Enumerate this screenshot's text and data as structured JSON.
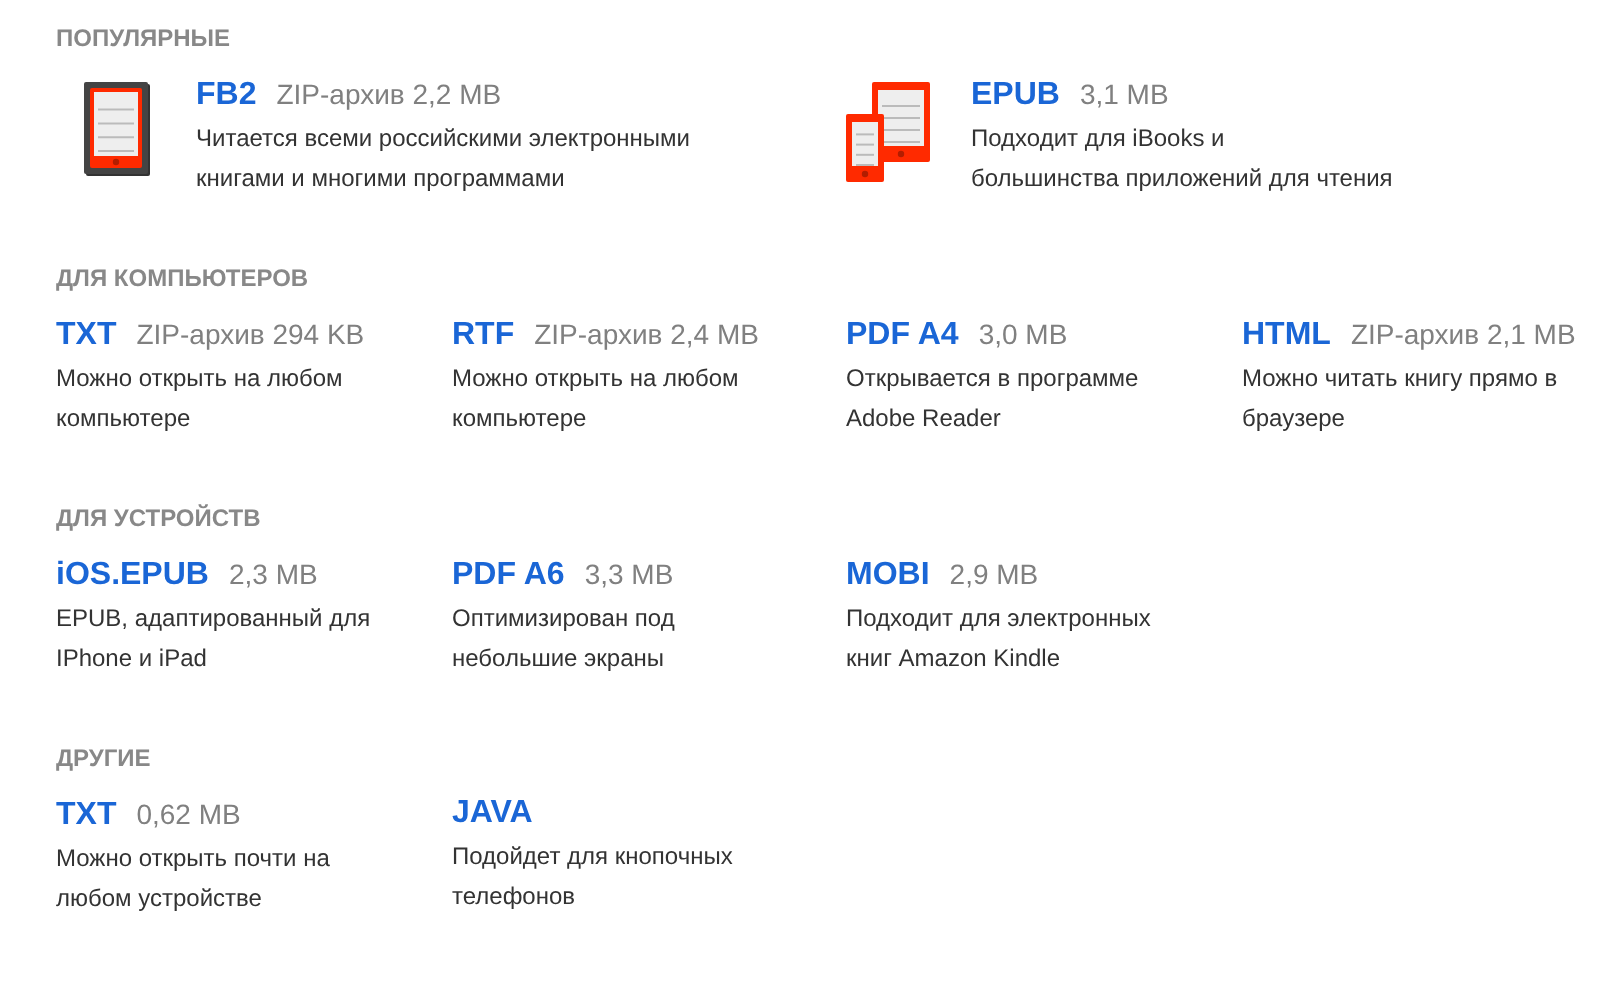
{
  "sections": [
    {
      "heading": "ПОПУЛЯРНЫЕ",
      "kind": "featured",
      "items": [
        {
          "kind": "reader",
          "format": "FB2",
          "size": "ZIP-архив 2,2 MB",
          "description_lines": [
            "Читается всеми российскими электронными",
            "книгами и многими программами"
          ]
        },
        {
          "kind": "readers",
          "format": "EPUB",
          "size": "3,1 MB",
          "description_lines": [
            "Подходит для iBooks и",
            "большинства приложений для чтения"
          ]
        }
      ]
    },
    {
      "heading": "ДЛЯ КОМПЬЮТЕРОВ",
      "kind": "grid",
      "items": [
        {
          "format": "TXT",
          "size": "ZIP-архив 294 KB",
          "description_lines": [
            "Можно открыть на любом",
            "компьютере"
          ]
        },
        {
          "format": "RTF",
          "size": "ZIP-архив 2,4 MB",
          "description_lines": [
            "Можно открыть на любом",
            "компьютере"
          ]
        },
        {
          "format": "PDF A4",
          "size": "3,0 MB",
          "description_lines": [
            "Открывается в программе",
            "Adobe Reader"
          ]
        },
        {
          "format": "HTML",
          "size": "ZIP-архив 2,1 MB",
          "description_lines": [
            "Можно читать книгу прямо в",
            "браузере"
          ]
        }
      ]
    },
    {
      "heading": "ДЛЯ УСТРОЙСТВ",
      "kind": "grid",
      "items": [
        {
          "format": "iOS.EPUB",
          "size": "2,3 MB",
          "description_lines": [
            "EPUB, адаптированный для",
            "IPhone и iPad"
          ]
        },
        {
          "format": "PDF A6",
          "size": "3,3 MB",
          "description_lines": [
            "Оптимизирован под",
            "небольшие экраны"
          ]
        },
        {
          "format": "MOBI",
          "size": "2,9 MB",
          "description_lines": [
            "Подходит для электронных",
            "книг Amazon Kindle"
          ]
        }
      ]
    },
    {
      "heading": "ДРУГИЕ",
      "kind": "grid",
      "items": [
        {
          "format": "TXT",
          "size": "0,62 MB",
          "description_lines": [
            "Можно открыть почти на",
            "любом устройстве"
          ]
        },
        {
          "format": "JAVA",
          "description_lines": [
            "Подойдет для кнопочных",
            "телефонов"
          ]
        }
      ]
    }
  ]
}
